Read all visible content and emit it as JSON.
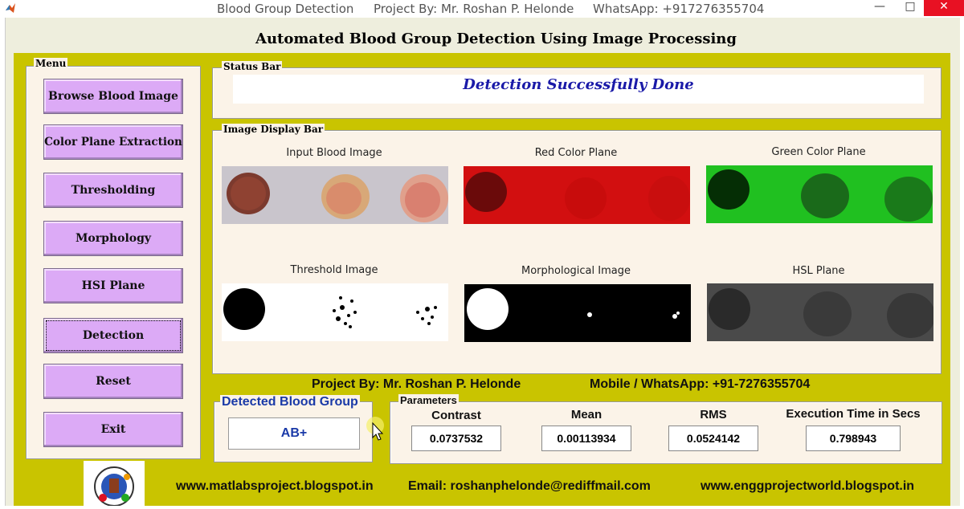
{
  "window": {
    "title_left": "Blood Group Detection",
    "title_mid": "Project By: Mr. Roshan P. Helonde",
    "title_right": "WhatsApp: +917276355704",
    "minimize": "—",
    "maximize": "□",
    "close": "✕"
  },
  "app_title": "Automated Blood Group Detection Using Image Processing",
  "menu": {
    "label": "Menu",
    "buttons": [
      "Browse Blood Image",
      "Color Plane Extraction",
      "Thresholding",
      "Morphology",
      "HSI Plane",
      "Detection",
      "Reset",
      "Exit"
    ]
  },
  "status_bar": {
    "label": "Status Bar",
    "message": "Detection Successfully Done"
  },
  "image_display": {
    "label": "Image Display Bar",
    "captions": [
      "Input Blood Image",
      "Red Color Plane",
      "Green Color Plane",
      "Threshold Image",
      "Morphological Image",
      "HSL Plane"
    ]
  },
  "info": {
    "project_by": "Project By: Mr. Roshan P. Helonde",
    "mobile": "Mobile / WhatsApp: +91-7276355704"
  },
  "result": {
    "label": "Detected Blood Group",
    "value": "AB+"
  },
  "parameters": {
    "label": "Parameters",
    "items": [
      {
        "name": "Contrast",
        "value": "0.0737532"
      },
      {
        "name": "Mean",
        "value": "0.00113934"
      },
      {
        "name": "RMS",
        "value": "0.0524142"
      },
      {
        "name": "Execution Time in Secs",
        "value": "0.798943"
      }
    ]
  },
  "footer": {
    "site1": "www.matlabsproject.blogspot.in",
    "email": "Email: roshanphelonde@rediffmail.com",
    "site2": "www.enggprojectworld.blogspot.in"
  },
  "colors": {
    "accent_green": "#c9c400",
    "button_purple": "#dcaaf6",
    "status_text": "#1a1aa8",
    "result_text": "#1a3aa8"
  }
}
